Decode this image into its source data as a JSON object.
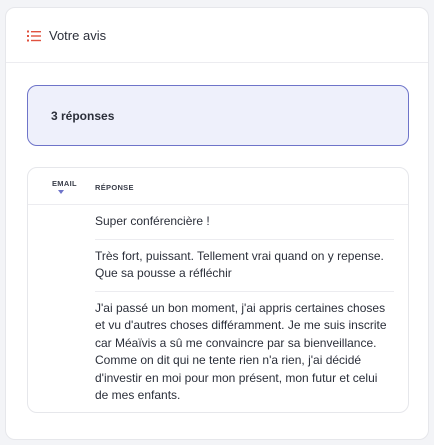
{
  "header": {
    "title": "Votre avis",
    "icon": "list-icon",
    "accent": "#e0523f"
  },
  "summary": {
    "text": "3 réponses"
  },
  "table": {
    "columns": [
      "EMAIL",
      "RÉPONSE"
    ],
    "sort_indicator": "sort-desc-icon",
    "rows": [
      {
        "email": "",
        "response": "Super conférencière !"
      },
      {
        "email": "",
        "response": "Très fort, puissant. Tellement vrai quand on y repense. Que sa pousse a réfléchir"
      },
      {
        "email": "",
        "response": "J'ai passé un bon moment, j'ai appris certaines choses et vu d'autres choses différamment. Je me suis inscrite car Méaïvis a sû me convaincre par sa bienveillance. Comme on dit qui ne tente rien n'a rien, j'ai décidé d'investir en moi pour mon présent, mon futur et celui de mes enfants."
      }
    ]
  },
  "colors": {
    "accent_border": "#6e74c9",
    "summary_bg": "#eef0fb",
    "icon": "#e0523f"
  }
}
